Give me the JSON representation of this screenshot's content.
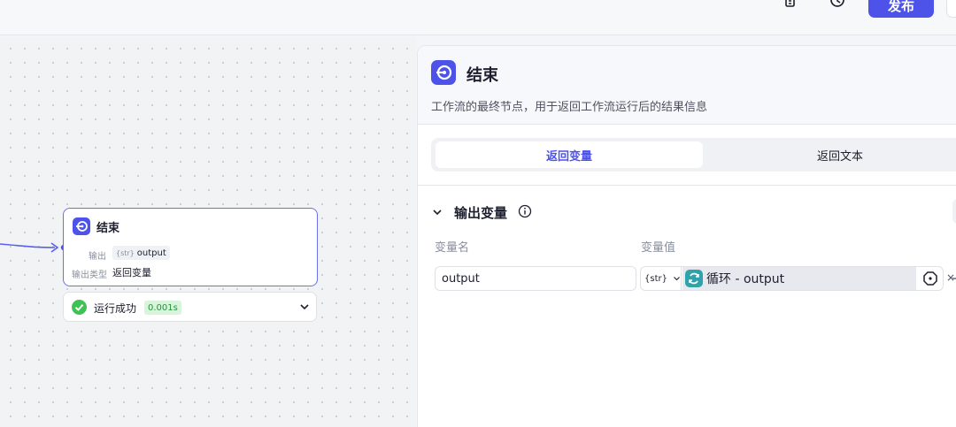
{
  "toolbar": {
    "copy_icon": "copy-icon",
    "history_icon": "history-icon",
    "publish_label": "发布"
  },
  "canvas": {
    "node": {
      "title": "结束",
      "output_label": "输出",
      "output_type_tag": "{str}",
      "output_name": "output",
      "output_kind_label": "输出类型",
      "output_kind_value": "返回变量"
    },
    "run": {
      "status": "运行成功",
      "duration": "0.001s"
    }
  },
  "panel": {
    "title": "结束",
    "description": "工作流的最终节点，用于返回工作流运行后的结果信息",
    "tabs": [
      "返回变量",
      "返回文本"
    ],
    "active_tab": 0,
    "section": {
      "title": "输出变量",
      "col_name": "变量名",
      "col_value": "变量值",
      "row": {
        "name_value": "output",
        "type_tag": "{str}",
        "ref_text": "循环 - output"
      }
    }
  },
  "colors": {
    "accent": "#4d53e8",
    "success": "#3ec254",
    "loop": "#2fa3a9"
  }
}
